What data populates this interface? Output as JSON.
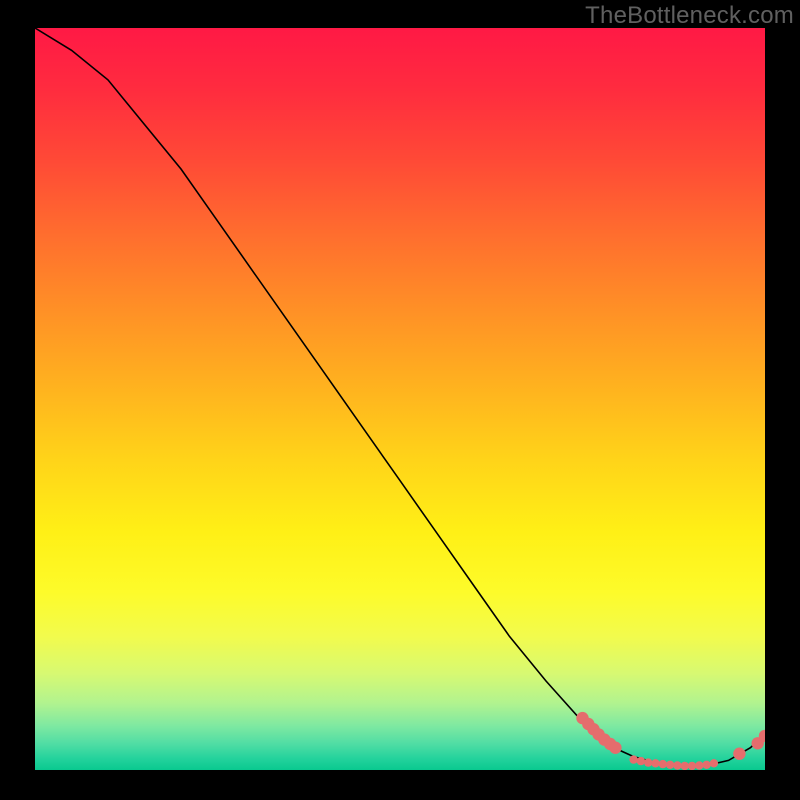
{
  "watermark": "TheBottleneck.com",
  "chart_data": {
    "type": "line",
    "title": "",
    "xlabel": "",
    "ylabel": "",
    "xlim": [
      0,
      100
    ],
    "ylim": [
      0,
      100
    ],
    "series": [
      {
        "name": "bottleneck-curve",
        "x": [
          0,
          5,
          10,
          15,
          20,
          25,
          30,
          35,
          40,
          45,
          50,
          55,
          60,
          65,
          70,
          75,
          78,
          80,
          82,
          85,
          88,
          90,
          92,
          95,
          98,
          100
        ],
        "y": [
          100,
          97,
          93,
          87,
          81,
          74,
          67,
          60,
          53,
          46,
          39,
          32,
          25,
          18,
          12,
          6.5,
          4,
          2.7,
          1.8,
          1.0,
          0.6,
          0.5,
          0.6,
          1.3,
          3.0,
          4.8
        ]
      }
    ],
    "points": [
      {
        "name": "segment-a",
        "x": 75.0,
        "y": 7.0
      },
      {
        "name": "segment-a",
        "x": 75.8,
        "y": 6.2
      },
      {
        "name": "segment-a",
        "x": 76.5,
        "y": 5.5
      },
      {
        "name": "segment-a",
        "x": 77.2,
        "y": 4.8
      },
      {
        "name": "segment-a",
        "x": 78.0,
        "y": 4.1
      },
      {
        "name": "segment-a",
        "x": 78.8,
        "y": 3.5
      },
      {
        "name": "segment-a",
        "x": 79.5,
        "y": 3.0
      },
      {
        "name": "bottom-cluster",
        "x": 82.0,
        "y": 1.4
      },
      {
        "name": "bottom-cluster",
        "x": 83.0,
        "y": 1.2
      },
      {
        "name": "bottom-cluster",
        "x": 84.0,
        "y": 1.0
      },
      {
        "name": "bottom-cluster",
        "x": 85.0,
        "y": 0.9
      },
      {
        "name": "bottom-cluster",
        "x": 86.0,
        "y": 0.8
      },
      {
        "name": "bottom-cluster",
        "x": 87.0,
        "y": 0.7
      },
      {
        "name": "bottom-cluster",
        "x": 88.0,
        "y": 0.6
      },
      {
        "name": "bottom-cluster",
        "x": 89.0,
        "y": 0.55
      },
      {
        "name": "bottom-cluster",
        "x": 90.0,
        "y": 0.55
      },
      {
        "name": "bottom-cluster",
        "x": 91.0,
        "y": 0.6
      },
      {
        "name": "bottom-cluster",
        "x": 92.0,
        "y": 0.7
      },
      {
        "name": "bottom-cluster",
        "x": 93.0,
        "y": 0.9
      },
      {
        "name": "upturn",
        "x": 96.5,
        "y": 2.2
      },
      {
        "name": "upturn",
        "x": 99.0,
        "y": 3.6
      },
      {
        "name": "upturn",
        "x": 100.0,
        "y": 4.6
      }
    ],
    "gradient_bands": [
      {
        "color": "#ff1945",
        "stop": 0
      },
      {
        "color": "#ffd319",
        "stop": 58
      },
      {
        "color": "#fdfb2a",
        "stop": 76
      },
      {
        "color": "#09c98f",
        "stop": 100
      }
    ]
  },
  "styles": {
    "point_fill": "#e56d6d",
    "point_radius_small": 4.2,
    "point_radius_large": 6.2,
    "curve_stroke": "#000000",
    "curve_width": 1.6
  }
}
